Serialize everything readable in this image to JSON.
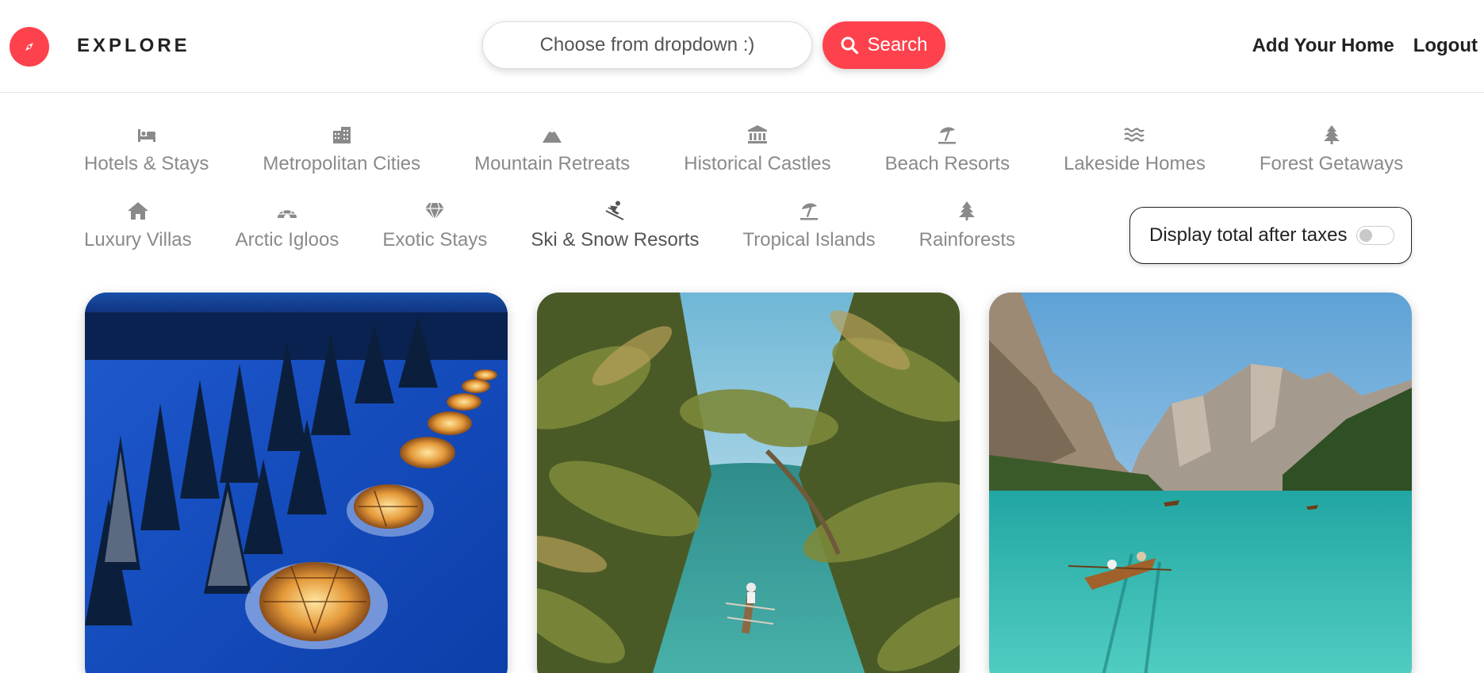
{
  "brand": {
    "name": "EXPLORE",
    "icon": "compass-icon"
  },
  "search": {
    "placeholder": "Choose from dropdown :)",
    "button_label": "Search",
    "button_icon": "search-icon"
  },
  "nav": {
    "add_home": "Add Your Home",
    "logout": "Logout"
  },
  "filters": [
    {
      "label": "Hotels & Stays",
      "icon": "bed-icon"
    },
    {
      "label": "Metropolitan Cities",
      "icon": "city-icon"
    },
    {
      "label": "Mountain Retreats",
      "icon": "mountain-icon"
    },
    {
      "label": "Historical Castles",
      "icon": "landmark-icon"
    },
    {
      "label": "Beach Resorts",
      "icon": "umbrella-beach-icon"
    },
    {
      "label": "Lakeside Homes",
      "icon": "water-icon"
    },
    {
      "label": "Forest Getaways",
      "icon": "tree-icon"
    },
    {
      "label": "Luxury Villas",
      "icon": "home-icon"
    },
    {
      "label": "Arctic Igloos",
      "icon": "igloo-icon"
    },
    {
      "label": "Exotic Stays",
      "icon": "gem-icon"
    },
    {
      "label": "Ski & Snow Resorts",
      "icon": "skiing-icon"
    },
    {
      "label": "Tropical Islands",
      "icon": "umbrella-beach-icon"
    },
    {
      "label": "Rainforests",
      "icon": "tree-icon"
    }
  ],
  "active_filter": "Ski & Snow Resorts",
  "tax_toggle": {
    "label": "Display total after taxes",
    "enabled": false
  },
  "listings": [
    {
      "image": "glass igloos in snowy forest at night"
    },
    {
      "image": "canoe on tropical palm river"
    },
    {
      "image": "rowboat on turquoise mountain lake"
    }
  ],
  "colors": {
    "accent": "#fe424d",
    "muted_text": "#8a8a8a",
    "text": "#222222"
  }
}
